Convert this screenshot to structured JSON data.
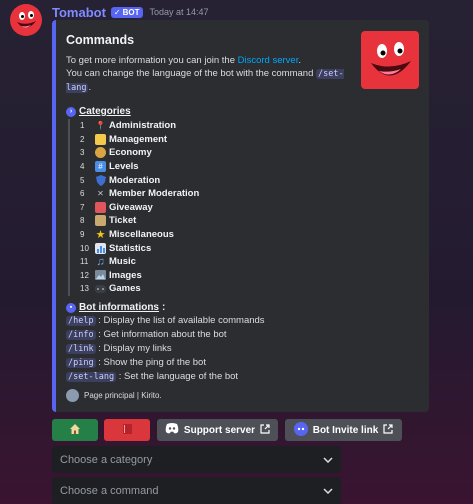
{
  "message": {
    "username": "Tomabot",
    "badge": "BOT",
    "timestamp": "Today at 14:47"
  },
  "embed": {
    "title": "Commands",
    "desc_prefix": "To get more information you can join the ",
    "desc_link": "Discord server",
    "desc_suffix": ".",
    "desc_line2": "You can change the language of the bot with the command ",
    "desc_code": "/set-lang",
    "desc_end": ".",
    "categories_title": "Categories",
    "categories": [
      {
        "num": "1",
        "label": "Administration",
        "icon": "pushpin-icon",
        "color": "#e23a3a"
      },
      {
        "num": "2",
        "label": "Management",
        "icon": "memo-icon",
        "color": "#f2c94c"
      },
      {
        "num": "3",
        "label": "Economy",
        "icon": "money-bag-icon",
        "color": "#d9a441"
      },
      {
        "num": "4",
        "label": "Levels",
        "icon": "numbers-icon",
        "color": "#4a8fe7"
      },
      {
        "num": "5",
        "label": "Moderation",
        "icon": "shield-icon",
        "color": "#3c6fd1"
      },
      {
        "num": "6",
        "label": "Member Moderation",
        "icon": "crossed-swords-icon",
        "color": "#a0a4ab"
      },
      {
        "num": "7",
        "label": "Giveaway",
        "icon": "party-popper-icon",
        "color": "#e0565c"
      },
      {
        "num": "8",
        "label": "Ticket",
        "icon": "ticket-icon",
        "color": "#c9a96e"
      },
      {
        "num": "9",
        "label": "Miscellaneous",
        "icon": "star-icon",
        "color": "#f5c518"
      },
      {
        "num": "10",
        "label": "Statistics",
        "icon": "chart-icon",
        "color": "#4a8fe7"
      },
      {
        "num": "11",
        "label": "Music",
        "icon": "music-note-icon",
        "color": "#6fa8dc"
      },
      {
        "num": "12",
        "label": "Images",
        "icon": "image-icon",
        "color": "#7a8a9a"
      },
      {
        "num": "13",
        "label": "Games",
        "icon": "controller-icon",
        "color": "#3a3d44"
      }
    ],
    "bot_info_title": "Bot informations",
    "bot_info_colon": " :",
    "commands": [
      {
        "cmd": "/help",
        "desc": " : Display the list of available commands"
      },
      {
        "cmd": "/info",
        "desc": " : Get information about the bot"
      },
      {
        "cmd": "/link",
        "desc": " : Display my links"
      },
      {
        "cmd": "/ping",
        "desc": " : Show the ping of the bot"
      },
      {
        "cmd": "/set-lang",
        "desc": " : Set the language of the bot"
      }
    ],
    "footer": "Page principal | Kirito."
  },
  "buttons": {
    "support": "Support server",
    "invite": "Bot Invite link"
  },
  "selects": {
    "category_placeholder": "Choose a category",
    "command_placeholder": "Choose a command"
  },
  "colors": {
    "accent": "#5865f2",
    "green": "#248046",
    "red": "#da373c",
    "link": "#00a8fc"
  }
}
